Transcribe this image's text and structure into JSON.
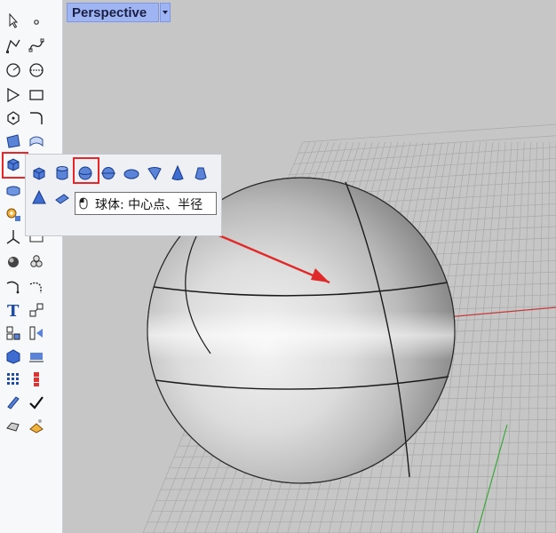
{
  "viewport": {
    "tab_label": "Perspective",
    "tab_dropdown_icon": "chevron-down-icon",
    "object": "sphere",
    "colors": {
      "background": "#c6c6c6",
      "grid": "#a9a9a9",
      "x_axis": "#c43a3a",
      "y_axis": "#3aa83a",
      "sphere": "#d8d8d8",
      "arrow": "#e02a2a"
    }
  },
  "toolbar": {
    "icons": [
      "select-icon",
      "point-icon",
      "polyline-icon",
      "curve-icon",
      "circle-icon",
      "ellipse-icon",
      "arc-icon",
      "rectangle-icon",
      "polygon-icon",
      "fillet-curve-icon",
      "surface-from-points-icon",
      "loft-surface-icon",
      "solid-box-icon",
      "mesh-icon",
      "transform-icon",
      "array-icon",
      "boolean-icon",
      "split-icon",
      "curve-from-objects-icon",
      "dimension-icon",
      "text-icon",
      "annotation-icon",
      "group-icon",
      "layer-icon",
      "render-icon",
      "grid-icon",
      "snap-icon",
      "analyze-icon",
      "display-icon",
      "check-icon",
      "material-icon",
      "light-icon"
    ]
  },
  "flyout": {
    "items": [
      "box-icon",
      "cylinder-icon",
      "sphere-center-radius-icon",
      "sphere-two-point-icon",
      "ellipsoid-icon",
      "paraboloid-icon",
      "cone-icon",
      "truncated-cone-icon",
      "pyramid-icon",
      "wedge-icon",
      "sphere-menu-icon"
    ]
  },
  "tooltip": {
    "text": "球体: 中心点、半径"
  }
}
